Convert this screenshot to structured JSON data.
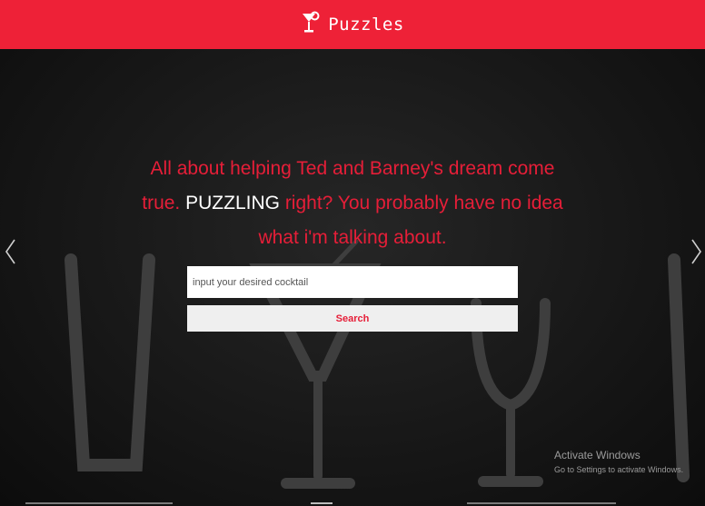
{
  "navbar": {
    "brand_icon": "cocktail-glass-icon",
    "brand_text": "Puzzles",
    "background": "#ee2137"
  },
  "hero": {
    "headline_part1": "All about helping Ted and Barney's dream come true.",
    "headline_highlight": "PUZZLING",
    "headline_part2": "right? You probably have no idea what i'm talking about.",
    "accent_color": "#e61e38"
  },
  "search": {
    "placeholder": "input your desired cocktail",
    "value": "",
    "button_label": "Search"
  },
  "carousel": {
    "prev_icon": "chevron-left-icon",
    "next_icon": "chevron-right-icon",
    "indicator_count": 3
  },
  "watermark": {
    "title": "Activate Windows",
    "subtitle": "Go to Settings to activate Windows."
  }
}
